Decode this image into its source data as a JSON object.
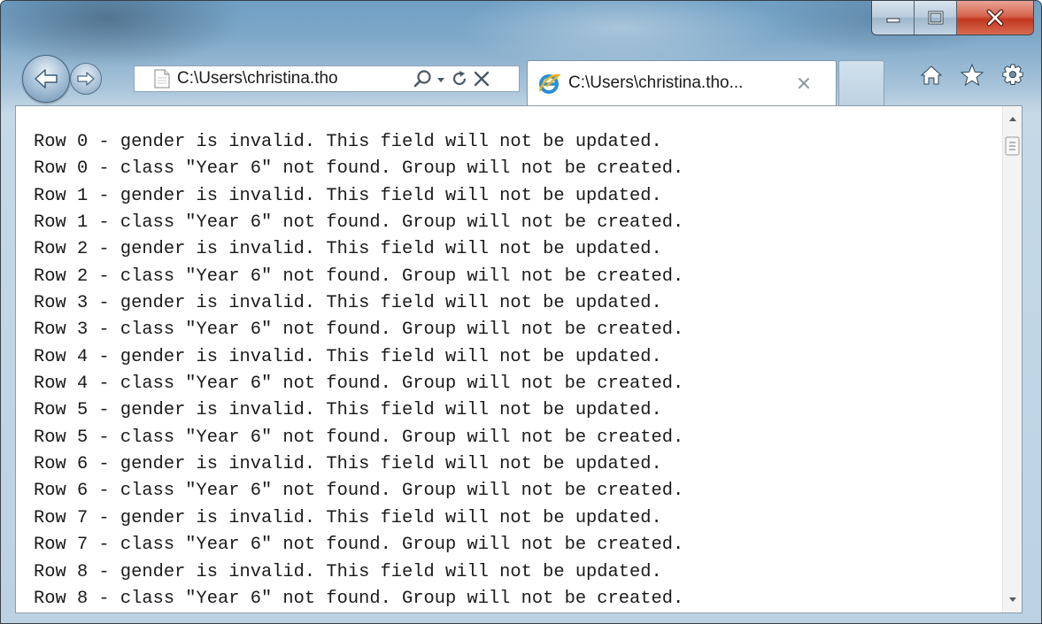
{
  "window": {
    "caption_buttons": [
      "minimize",
      "maximize",
      "close"
    ]
  },
  "toolbar": {
    "address": "C:\\Users\\christina.tho",
    "active_tab_title": "C:\\Users\\christina.tho...",
    "icons": [
      "back-arrow-icon",
      "forward-arrow-icon",
      "page-icon",
      "search-icon",
      "dropdown-icon",
      "refresh-icon",
      "stop-icon",
      "ie-icon",
      "close-tab-icon",
      "home-icon",
      "favorites-star-icon",
      "gear-icon"
    ]
  },
  "content": {
    "lines": [
      "Row 0 - gender is invalid. This field will not be updated.",
      "Row 0 - class \"Year 6\" not found. Group will not be created.",
      "Row 1 - gender is invalid. This field will not be updated.",
      "Row 1 - class \"Year 6\" not found. Group will not be created.",
      "Row 2 - gender is invalid. This field will not be updated.",
      "Row 2 - class \"Year 6\" not found. Group will not be created.",
      "Row 3 - gender is invalid. This field will not be updated.",
      "Row 3 - class \"Year 6\" not found. Group will not be created.",
      "Row 4 - gender is invalid. This field will not be updated.",
      "Row 4 - class \"Year 6\" not found. Group will not be created.",
      "Row 5 - gender is invalid. This field will not be updated.",
      "Row 5 - class \"Year 6\" not found. Group will not be created.",
      "Row 6 - gender is invalid. This field will not be updated.",
      "Row 6 - class \"Year 6\" not found. Group will not be created.",
      "Row 7 - gender is invalid. This field will not be updated.",
      "Row 7 - class \"Year 6\" not found. Group will not be created.",
      "Row 8 - gender is invalid. This field will not be updated.",
      "Row 8 - class \"Year 6\" not found. Group will not be created."
    ]
  },
  "colors": {
    "frame": "#bcd2e3",
    "close_button": "#c2381f",
    "text": "#1a1a1a"
  }
}
